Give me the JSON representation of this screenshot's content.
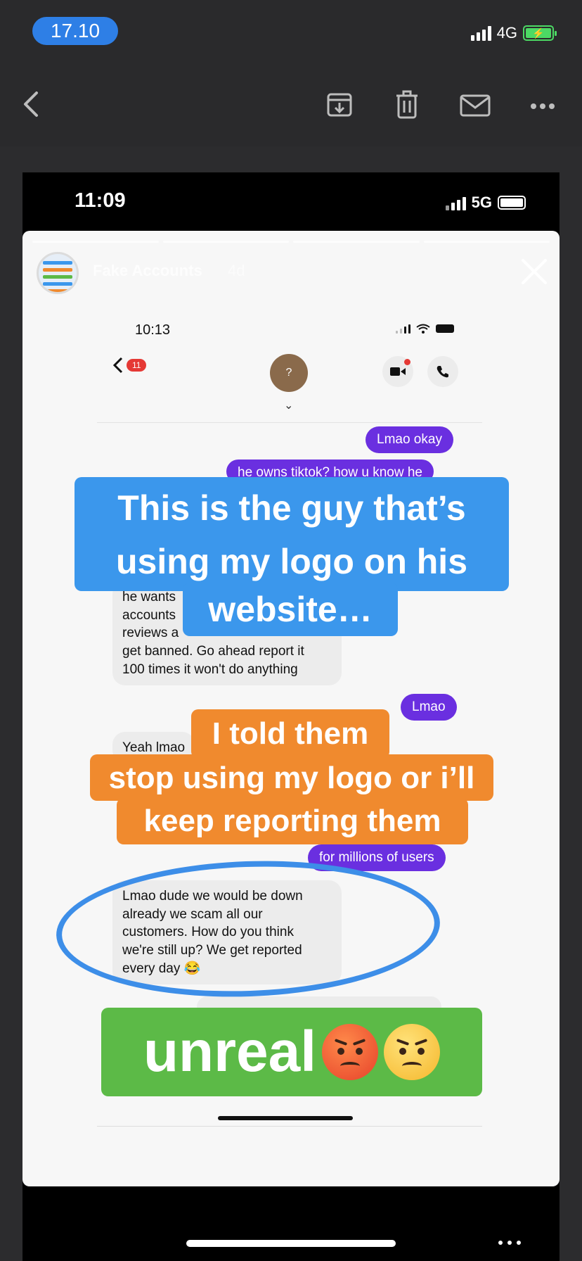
{
  "outer_status": {
    "time": "17.10",
    "network": "4G"
  },
  "inner_status": {
    "time": "11:09",
    "network": "5G"
  },
  "story": {
    "account_name": "Fake Accounts",
    "age": "4d"
  },
  "chat": {
    "time": "10:13",
    "unread_badge": "11",
    "avatar_placeholder": "?",
    "messages": {
      "m1": "Lmao okay",
      "m2": "he owns tiktok? how u know he",
      "m3_line1": "he wants",
      "m3_line2": "accounts",
      "m3_line3": "reviews a",
      "m3_line4": "get banned. Go ahead report it",
      "m3_line5": "100 times it won't do anything",
      "m4": "Lmao",
      "m5": "Yeah lmao",
      "m6": "for millions of users",
      "m7_line1": "Lmao dude we would be down",
      "m7_line2": "already we scam all our",
      "m7_line3": "customers. How do you think",
      "m7_line4": "we're still up? We get reported",
      "m7_line5": "every day 😂"
    }
  },
  "overlays": {
    "blue_line1": "This is the guy that’s",
    "blue_line2": "using my logo on his",
    "blue_line3": "website…",
    "orange_line1": "I told them",
    "orange_line2": "stop using my logo or i’ll",
    "orange_line3": "keep reporting them",
    "green": "unreal"
  },
  "colors": {
    "blue": "#3b97ec",
    "orange": "#f08a2e",
    "green": "#5cba47",
    "purple_bubble": "#6a2fe0",
    "accent_pill": "#2e7fe6"
  }
}
